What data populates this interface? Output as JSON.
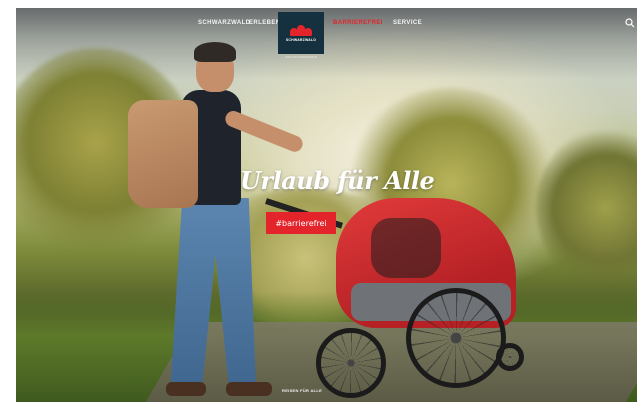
{
  "nav": {
    "items": [
      {
        "label": "SCHWARZWALD",
        "active": false
      },
      {
        "label": "ERLEBEN",
        "active": false
      },
      {
        "label": "BARRIEREFREI",
        "active": true
      },
      {
        "label": "SERVICE",
        "active": false
      }
    ]
  },
  "logo": {
    "text": "SCHWARZWALD",
    "subtitle": "HOCHSCHWARZWALD"
  },
  "hero": {
    "headline": "Urlaub für Alle",
    "tag_label": "#barrierefrei",
    "footer_link": "REISEN FÜR ALLE"
  },
  "icons": {
    "search": "search-icon",
    "logo_mark": "logo-mark-icon"
  },
  "colors": {
    "accent": "#e3242b",
    "logo_bg": "#15303f",
    "nav_text": "#f2f2f2"
  }
}
